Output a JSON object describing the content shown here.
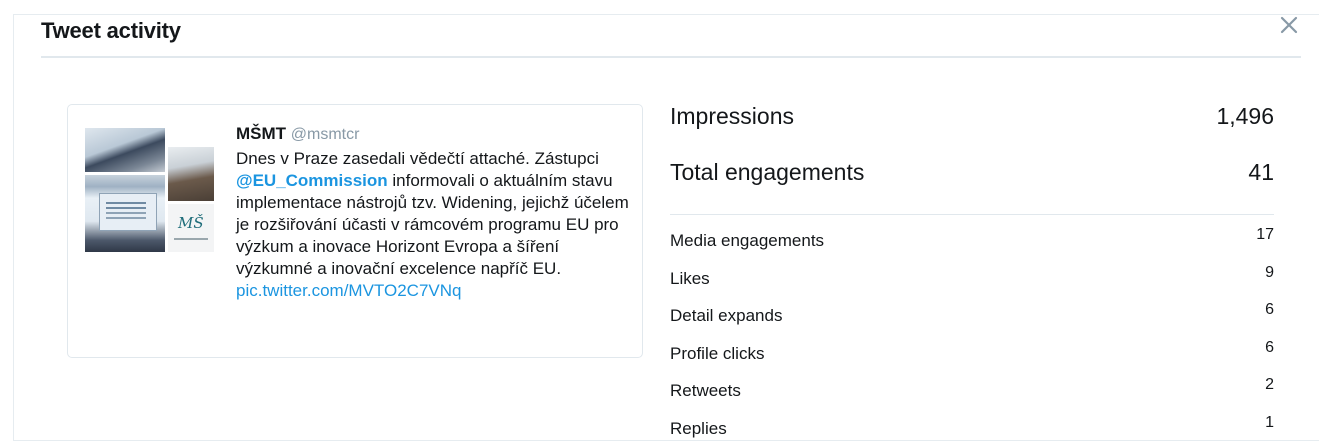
{
  "dialog": {
    "title": "Tweet activity",
    "close_icon": "close-icon"
  },
  "tweet": {
    "author_name": "MŠMT",
    "author_handle": "@msmtcr",
    "text_before_mention": "Dnes v Praze zasedali vědečtí attaché. Zástupci ",
    "mention": "@EU_Commission",
    "text_after_mention": " informovali o aktuálním stavu implementace nástrojů tzv. Widening, jejichž účelem je rozšiřování účasti v rámcovém programu EU pro výzkum a inovace Horizont Evropa a šíření výzkumné a inovační excelence napříč EU.",
    "pic_link": "pic.twitter.com/MVTO2C7VNq",
    "media_logo": "MŠ"
  },
  "metrics": {
    "impressions": {
      "label": "Impressions",
      "value": "1,496"
    },
    "total_engagements": {
      "label": "Total engagements",
      "value": "41"
    },
    "breakdown": [
      {
        "label": "Media engagements",
        "value": "17"
      },
      {
        "label": "Likes",
        "value": "9"
      },
      {
        "label": "Detail expands",
        "value": "6"
      },
      {
        "label": "Profile clicks",
        "value": "6"
      },
      {
        "label": "Retweets",
        "value": "2"
      },
      {
        "label": "Replies",
        "value": "1"
      }
    ]
  },
  "colors": {
    "link": "#1b95e0",
    "handle": "#8899a6",
    "close": "#8899a6",
    "divider": "#e1e8ed"
  }
}
